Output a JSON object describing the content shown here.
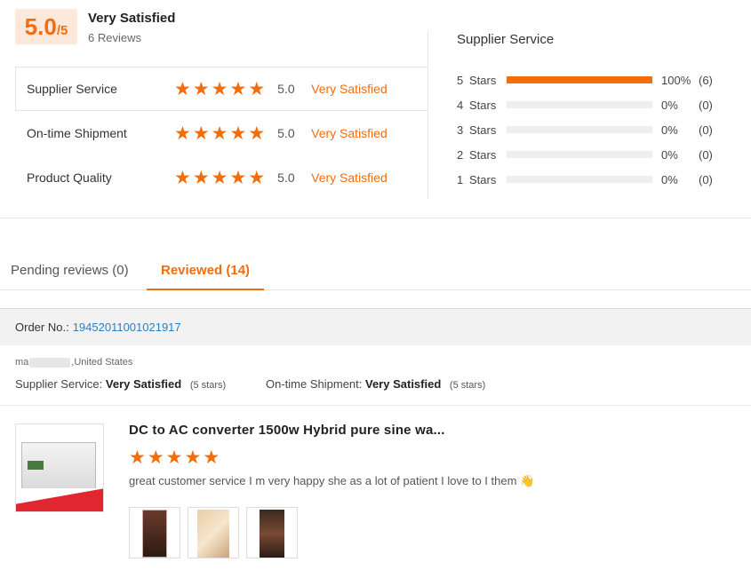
{
  "summary": {
    "score_big": "5.0",
    "score_small": "/5",
    "overall_label": "Very Satisfied",
    "review_count": "6 Reviews",
    "ratings": [
      {
        "label": "Supplier Service",
        "value": "5.0",
        "satisfaction": "Very Satisfied",
        "stars": 5
      },
      {
        "label": "On-time Shipment",
        "value": "5.0",
        "satisfaction": "Very Satisfied",
        "stars": 5
      },
      {
        "label": "Product Quality",
        "value": "5.0",
        "satisfaction": "Very Satisfied",
        "stars": 5
      }
    ]
  },
  "distribution": {
    "title": "Supplier Service",
    "rows": [
      {
        "n": "5",
        "unit": "Stars",
        "fraction": 1.0,
        "pct": "100%",
        "count": "(6)"
      },
      {
        "n": "4",
        "unit": "Stars",
        "fraction": 0,
        "pct": "0%",
        "count": "(0)"
      },
      {
        "n": "3",
        "unit": "Stars",
        "fraction": 0,
        "pct": "0%",
        "count": "(0)"
      },
      {
        "n": "2",
        "unit": "Stars",
        "fraction": 0,
        "pct": "0%",
        "count": "(0)"
      },
      {
        "n": "1",
        "unit": "Stars",
        "fraction": 0,
        "pct": "0%",
        "count": "(0)"
      }
    ],
    "accent_color": "#f26d0c"
  },
  "tabs": {
    "pending": "Pending reviews (0)",
    "reviewed": "Reviewed (14)"
  },
  "order": {
    "label": "Order No.:",
    "number": "19452011001021917"
  },
  "review": {
    "buyer_prefix": "ma",
    "buyer_country": ",United States",
    "supplier_service_label": "Supplier Service:",
    "supplier_service_value": "Very Satisfied",
    "supplier_service_stars": "(5 stars)",
    "shipment_label": "On-time Shipment:",
    "shipment_value": "Very Satisfied",
    "shipment_stars": "(5 stars)",
    "product_title": "DC to AC converter 1500w Hybrid pure sine wa...",
    "product_stars": 5,
    "comment": "great customer service I m very happy she as a lot of patient  I love to I them 👋"
  }
}
